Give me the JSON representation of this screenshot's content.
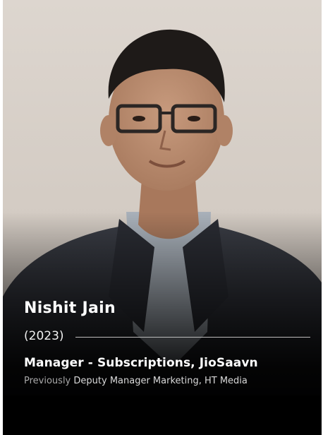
{
  "profile": {
    "name": "Nishit Jain",
    "year": "(2023)",
    "role": "Manager - Subscriptions, JioSaavn",
    "previous_label": "Previously",
    "previous_role": "Deputy Manager Marketing, HT Media",
    "photo_icon": "person-portrait-icon"
  },
  "colors": {
    "card_background": "#000000",
    "backdrop": "#d9d1c9",
    "text_primary": "#ffffff",
    "text_secondary": "#d9d9d9",
    "divider": "#bdbdbd"
  }
}
